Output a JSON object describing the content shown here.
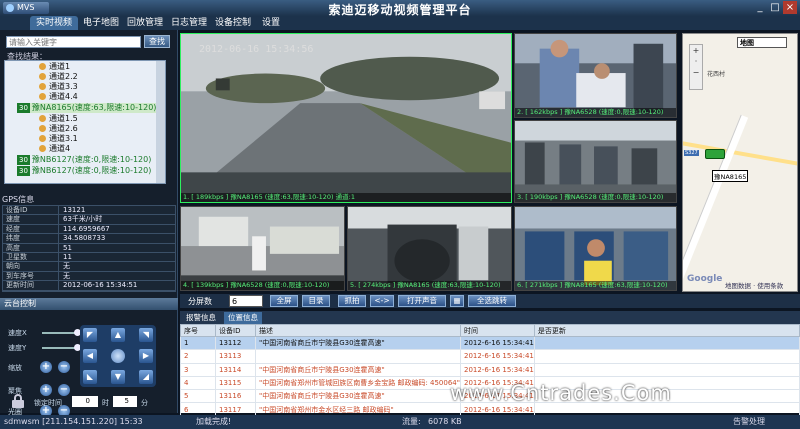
{
  "app": {
    "logo": "MVS",
    "title": "索迪迈移动视频管理平台",
    "minimize": "_",
    "maximize": "□",
    "close": "×"
  },
  "menu": [
    "实时视频",
    "电子地图",
    "回放管理",
    "日志管理",
    "设备控制",
    "设置"
  ],
  "search": {
    "placeholder": "请输入关键字",
    "button": "查找",
    "result_label": "查找结果："
  },
  "tree": [
    {
      "type": "cam",
      "label": "通道1"
    },
    {
      "type": "cam",
      "label": "通道2.2"
    },
    {
      "type": "cam",
      "label": "通道3.3"
    },
    {
      "type": "cam",
      "label": "通道4.4"
    },
    {
      "type": "veh",
      "badge": "30",
      "label": "豫NA8165(速度:63,限速:10-120)"
    },
    {
      "type": "cam",
      "label": "通道1.5"
    },
    {
      "type": "cam",
      "label": "通道2.6"
    },
    {
      "type": "cam",
      "label": "通道3.1"
    },
    {
      "type": "cam",
      "label": "通道4"
    },
    {
      "type": "veh",
      "badge": "30",
      "label": "豫NB6127(速度:0,限速:10-120)"
    },
    {
      "type": "veh",
      "badge": "30",
      "label": "豫NB6127(速度:0,限速:10-120)"
    }
  ],
  "gps": {
    "title": "GPS信息",
    "rows": [
      {
        "k": "设备ID",
        "v": "13121"
      },
      {
        "k": "速度",
        "v": "63千米/小时"
      },
      {
        "k": "经度",
        "v": "114.6959667"
      },
      {
        "k": "纬度",
        "v": "34.5808733"
      },
      {
        "k": "高度",
        "v": "51"
      },
      {
        "k": "卫星数",
        "v": "11"
      },
      {
        "k": "朝向",
        "v": "无"
      },
      {
        "k": "到车序号",
        "v": "无"
      },
      {
        "k": "更新时间",
        "v": "2012-06-16 15:34:51"
      }
    ]
  },
  "ptz": {
    "title": "云台控制",
    "speed_h": "速度X",
    "speed_v": "速度Y",
    "speed_val": "4",
    "zoom": "缩放",
    "focus": "聚焦",
    "iris": "光圈",
    "lock_label": "锁定时间",
    "lock_hours": "0",
    "hour_unit": "时",
    "lock_minutes": "5",
    "minute_unit": "分"
  },
  "videos": {
    "timestamp": "2012-06-16 15:34:56",
    "labels": [
      "1. [ 189kbps ] 豫NA8165 (速度:63,限速:10-120) 通道:1",
      "2. [ 162kbps ] 豫NA6528 (速度:0,限速:10-120)",
      "3. [ 190kbps ] 豫NA6528 (速度:0,限速:10-120)",
      "4. [ 139kbps ] 豫NA6528 (速度:0,限速:10-120)",
      "5. [ 274kbps ] 豫NA8165 (速度:63,限速:10-120)",
      "6. [ 271kbps ] 豫NA8165 (速度:63,限速:10-120)"
    ]
  },
  "map": {
    "type": "地图",
    "place": "花西村",
    "route": "S327",
    "plate": "豫NA8165",
    "copyright": "地图数据 · 使用条款",
    "google": "Google"
  },
  "controls": {
    "split_label": "分屏数",
    "split_value": "6",
    "buttons": [
      "全屏",
      "目录",
      "抓拍",
      "<->",
      "打开声音",
      "全选跳转"
    ]
  },
  "bottom": {
    "tabs": [
      "报警信息",
      "位置信息"
    ],
    "columns": [
      "序号",
      "设备ID",
      "描述",
      "时间",
      "是否更新"
    ],
    "rows": [
      {
        "seq": "1",
        "id": "13112",
        "desc": "\"中国河南省商丘市宁陵县G30连霍高速\"",
        "time": "2012-6-16 15:34:41",
        "upd": ""
      },
      {
        "seq": "2",
        "id": "13113",
        "desc": "",
        "time": "2012-6-16 15:34:41",
        "upd": ""
      },
      {
        "seq": "3",
        "id": "13114",
        "desc": "\"中国河南省商丘市宁陵县G30连霍高速\"",
        "time": "2012-6-16 15:34:41",
        "upd": ""
      },
      {
        "seq": "4",
        "id": "13115",
        "desc": "\"中国河南省郑州市管城回族区南曹乡金宝路 邮政编码: 450064\"",
        "time": "2012-6-16 15:34:41",
        "upd": ""
      },
      {
        "seq": "5",
        "id": "13116",
        "desc": "\"中国河南省商丘市宁陵县G30连霍高速\"",
        "time": "2012-6-16 15:34:41",
        "upd": ""
      },
      {
        "seq": "6",
        "id": "13117",
        "desc": "\"中国河南省郑州市金水区经三路 邮政编码\"",
        "time": "2012-6-16 15:34:41",
        "upd": ""
      }
    ]
  },
  "watermark": "www.Cntrades.Com",
  "status": {
    "user": "sdmwsm [211.154.151.220] 15:33",
    "loaded": "加载完成!",
    "traffic_label": "流量:",
    "traffic_value": "6078 KB",
    "alarm": "告警处理"
  }
}
